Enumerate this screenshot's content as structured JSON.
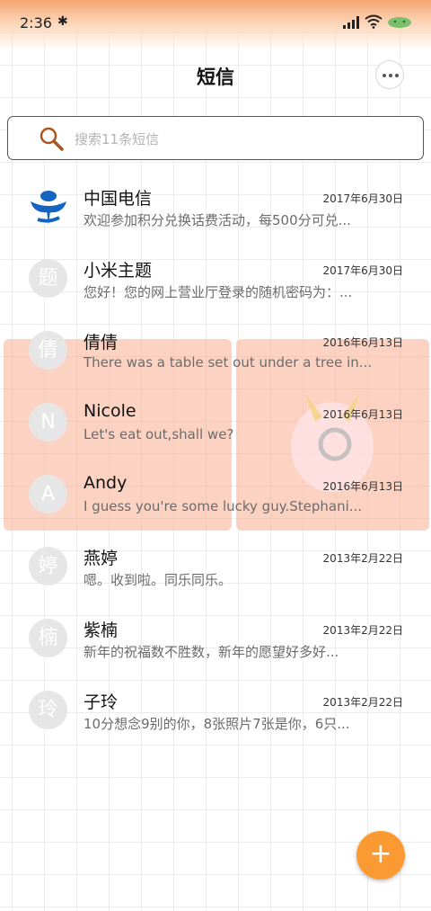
{
  "status_bar": {
    "time": "2:36"
  },
  "header": {
    "title": "短信"
  },
  "search": {
    "placeholder": "搜索11条短信"
  },
  "conversations": [
    {
      "name": "中国电信",
      "date": "2017年6月30日",
      "preview": "欢迎参加积分兑换话费活动，每500分可兑...",
      "avatar": "telecom-logo"
    },
    {
      "name": "小米主题",
      "date": "2017年6月30日",
      "preview": "您好！您的网上营业厅登录的随机密码为：...",
      "avatar": "题"
    },
    {
      "name": "倩倩",
      "date": "2016年6月13日",
      "preview": "There was a table set out under a tree in...",
      "avatar": "倩"
    },
    {
      "name": "Nicole",
      "date": "2016年6月13日",
      "preview": "Let's eat out,shall we?",
      "avatar": "N"
    },
    {
      "name": "Andy",
      "date": "2016年6月13日",
      "preview": "I guess you're some lucky guy.Stephani...",
      "avatar": "A"
    },
    {
      "name": "燕婷",
      "date": "2013年2月22日",
      "preview": "嗯。收到啦。同乐同乐。",
      "avatar": "婷"
    },
    {
      "name": "紫楠",
      "date": "2013年2月22日",
      "preview": "新年的祝福数不胜数，新年的愿望好多好...",
      "avatar": "楠"
    },
    {
      "name": "子玲",
      "date": "2013年2月22日",
      "preview": "10分想念9别的你，8张照片7张是你，6只...",
      "avatar": "玲"
    }
  ],
  "fab": {
    "label": "+"
  },
  "colors": {
    "accent": "#fb9a33",
    "status_gradient": "#f6a66f",
    "overlay": "#faaf91"
  }
}
